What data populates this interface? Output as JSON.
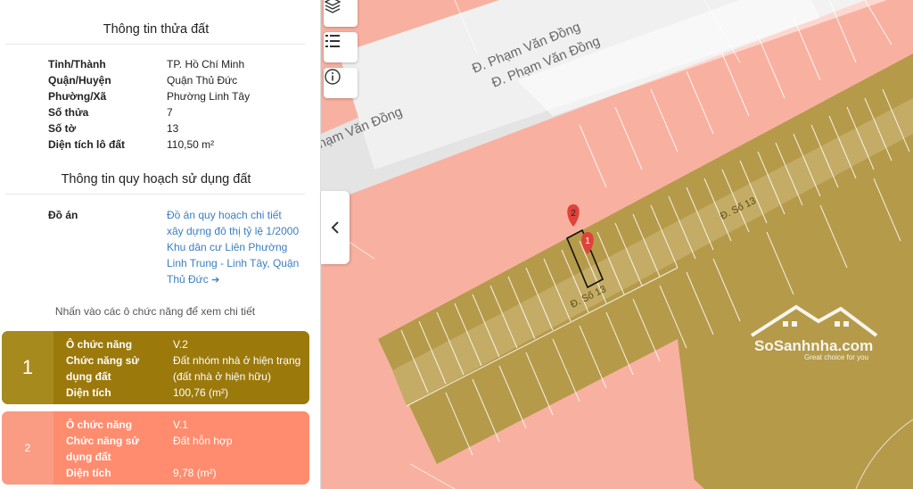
{
  "land_info": {
    "title": "Thông tin thửa đất",
    "rows": [
      {
        "label": "Tỉnh/Thành",
        "value": "TP. Hồ Chí Minh"
      },
      {
        "label": "Quận/Huyện",
        "value": "Quận Thủ Đức"
      },
      {
        "label": "Phường/Xã",
        "value": "Phường Linh Tây"
      },
      {
        "label": "Số thửa",
        "value": "7"
      },
      {
        "label": "Số tờ",
        "value": "13"
      },
      {
        "label": "Diện tích lô đất",
        "value": "110,50 m²"
      }
    ]
  },
  "planning": {
    "title": "Thông tin quy hoạch sử dụng đất",
    "plan_label": "Đồ án",
    "plan_link": "Đồ án quy hoạch chi tiết xây dựng đô thị tỷ lệ 1/2000 Khu dân cư Liên Phường Linh Trung - Linh Tây, Quận Thủ Đức",
    "plan_link_arrow": "➔",
    "hint": "Nhấn vào các ô chức năng để xem chi tiết"
  },
  "cards": [
    {
      "number": "1",
      "color": "#9b790b",
      "cell_label": "Ô chức năng",
      "cell_value": "V.2",
      "func_label": "Chức năng sử dụng đất",
      "func_value": "Đất nhóm nhà ở hiện trạng (đất nhà ở hiện hữu)",
      "area_label": "Diện tích",
      "area_value": "100,76 (m²)"
    },
    {
      "number": "2",
      "color": "#ff8c6e",
      "cell_label": "Ô chức năng",
      "cell_value": "V.1",
      "func_label": "Chức năng sử dụng đất",
      "func_value": "Đất hỗn hợp",
      "area_label": "Diện tích",
      "area_value": "9,78 (m²)"
    }
  ],
  "map": {
    "street_main_1": "Đ. Phạm Văn Đồng",
    "street_main_2": "Đ. Phạm Văn Đồng",
    "street_main_3": "Phạm Văn Đồng",
    "street_so13_a": "Đ. Số 13",
    "street_so13_b": "Đ. Số 13",
    "marker_1": "1",
    "marker_2": "2",
    "colors": {
      "mixed": "#f8b1a0",
      "residential": "#b59a4a",
      "road": "#e6e6e6",
      "marker": "#e0413a"
    },
    "icons": [
      "layers-icon",
      "list-icon",
      "info-icon",
      "chevron-left-icon"
    ]
  },
  "watermark": {
    "brand": "SoSanhnha.com",
    "tagline": "Great choice for you"
  }
}
